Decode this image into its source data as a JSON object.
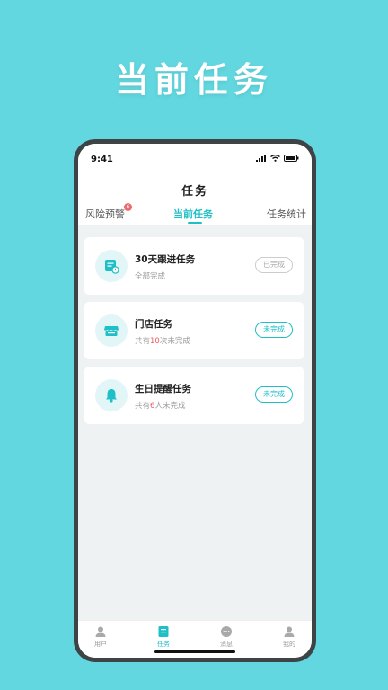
{
  "promo": {
    "headline": "当前任务"
  },
  "status_bar": {
    "time": "9:41"
  },
  "header": {
    "title": "任务",
    "tabs": [
      {
        "label": "风险预警",
        "badge": "6"
      },
      {
        "label": "当前任务"
      },
      {
        "label": "任务统计"
      }
    ]
  },
  "tasks": [
    {
      "title": "30天跟进任务",
      "sub": "全部完成",
      "button": "已完成",
      "icon": "calendar-clock-icon"
    },
    {
      "title": "门店任务",
      "sub_prefix": "共有",
      "sub_count": "10",
      "sub_suffix": "次未完成",
      "button": "未完成",
      "icon": "store-icon"
    },
    {
      "title": "生日提醒任务",
      "sub_prefix": "共有",
      "sub_count": "6",
      "sub_suffix": "人未完成",
      "button": "未完成",
      "icon": "bell-icon"
    }
  ],
  "tabbar": [
    {
      "label": "用户",
      "icon": "user-icon"
    },
    {
      "label": "任务",
      "icon": "task-icon"
    },
    {
      "label": "消息",
      "icon": "message-icon"
    },
    {
      "label": "我的",
      "icon": "profile-icon"
    }
  ],
  "colors": {
    "background": "#62d7df",
    "accent": "#1fbfc7",
    "highlight": "#ef5b5b"
  }
}
